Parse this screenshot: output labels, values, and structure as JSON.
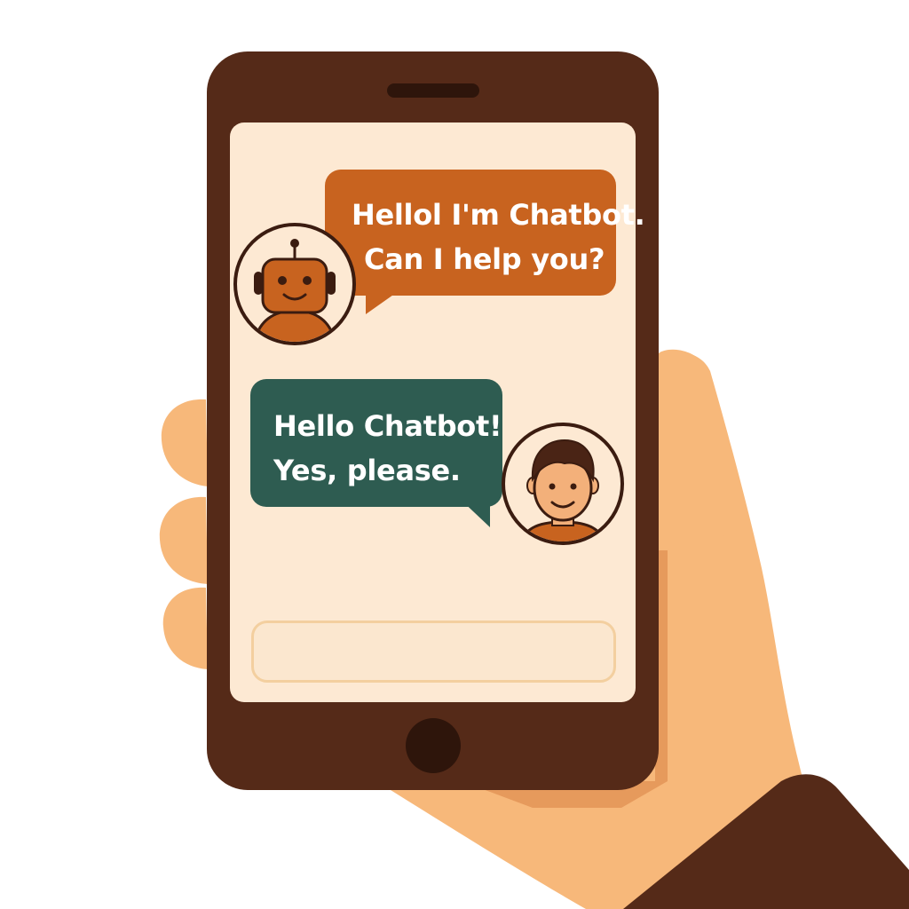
{
  "chat": {
    "bot_message": {
      "lines": [
        "Hellol I'm Chatbot.",
        "Can I help you?"
      ]
    },
    "user_message": {
      "lines": [
        "Hello Chatbot!",
        "Yes, please."
      ]
    },
    "input": {
      "value": "",
      "placeholder": ""
    }
  },
  "icons": {
    "bot_avatar": "robot-avatar-icon",
    "user_avatar": "person-avatar-icon",
    "home_button": "home-button-icon",
    "speaker": "speaker-grille-icon"
  },
  "colors": {
    "phone_body": "#552a18",
    "screen": "#fde9d3",
    "bot_bubble": "#c8631f",
    "user_bubble": "#2e5c51",
    "skin": "#f7b87a",
    "sleeve": "#552a18",
    "text": "#ffffff"
  }
}
